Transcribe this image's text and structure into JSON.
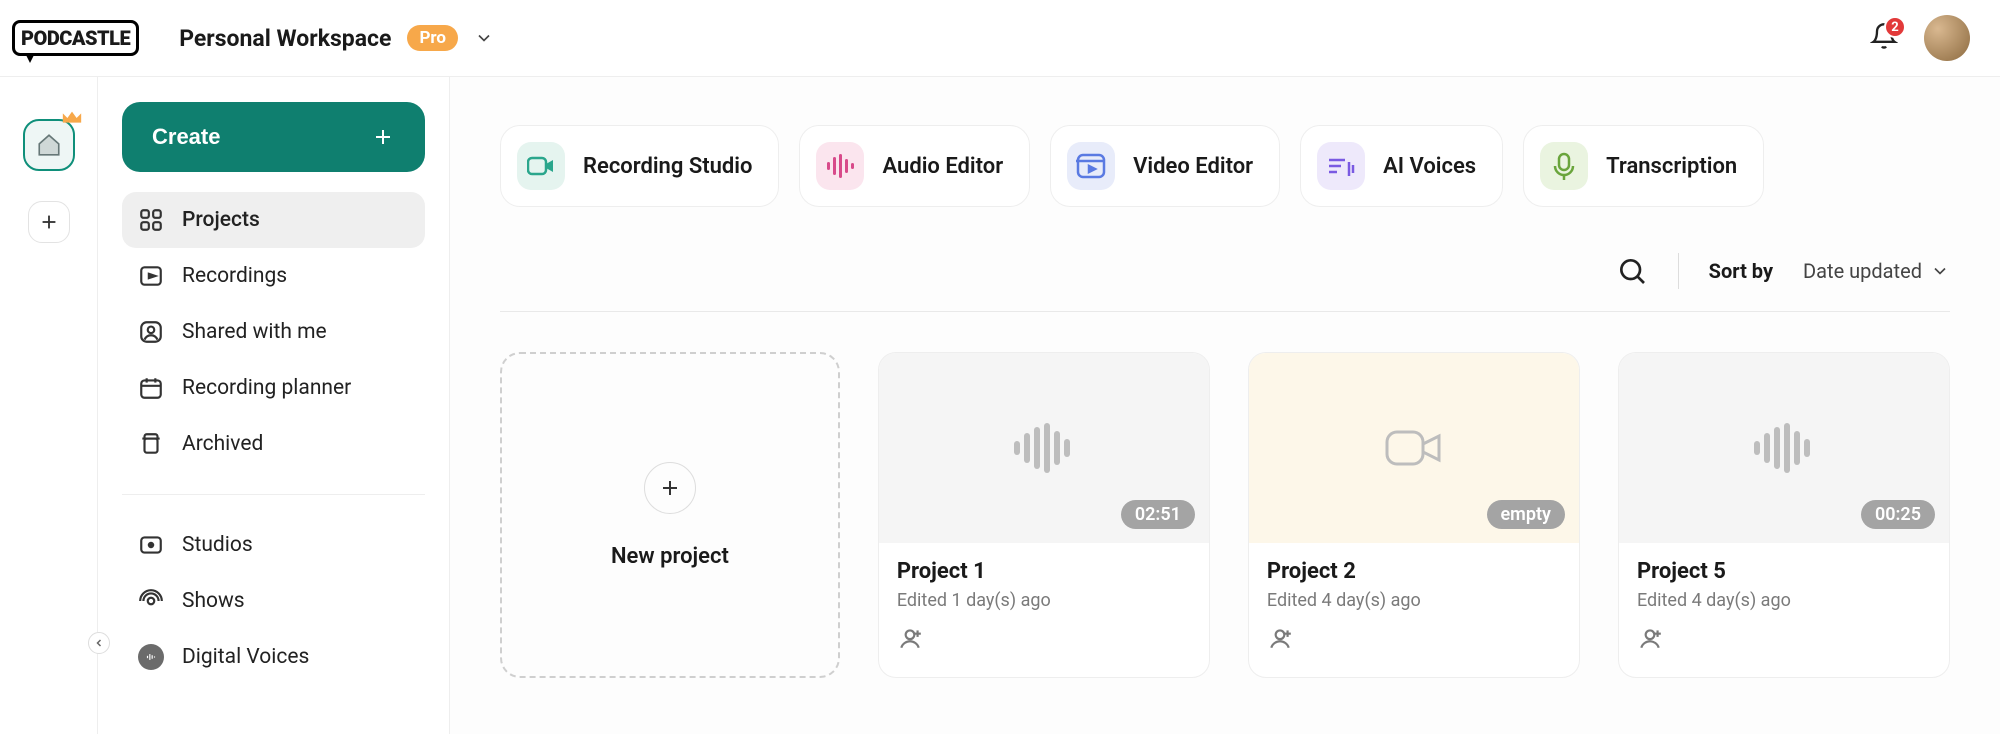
{
  "header": {
    "logo_text": "PODCASTLE",
    "workspace_name": "Personal Workspace",
    "plan_badge": "Pro",
    "notification_count": "2"
  },
  "sidebar": {
    "create_label": "Create",
    "nav1": [
      {
        "label": "Projects"
      },
      {
        "label": "Recordings"
      },
      {
        "label": "Shared with me"
      },
      {
        "label": "Recording planner"
      },
      {
        "label": "Archived"
      }
    ],
    "nav2": [
      {
        "label": "Studios"
      },
      {
        "label": "Shows"
      },
      {
        "label": "Digital Voices"
      }
    ]
  },
  "tools": [
    {
      "label": "Recording Studio"
    },
    {
      "label": "Audio Editor"
    },
    {
      "label": "Video Editor"
    },
    {
      "label": "AI Voices"
    },
    {
      "label": "Transcription"
    }
  ],
  "sort": {
    "label": "Sort by",
    "value": "Date updated"
  },
  "projects": {
    "new_label": "New project",
    "items": [
      {
        "title": "Project 1",
        "subtitle": "Edited 1 day(s) ago",
        "duration": "02:51",
        "kind": "audio"
      },
      {
        "title": "Project 2",
        "subtitle": "Edited 4 day(s) ago",
        "duration": "empty",
        "kind": "video"
      },
      {
        "title": "Project 5",
        "subtitle": "Edited 4 day(s) ago",
        "duration": "00:25",
        "kind": "audio"
      }
    ]
  }
}
